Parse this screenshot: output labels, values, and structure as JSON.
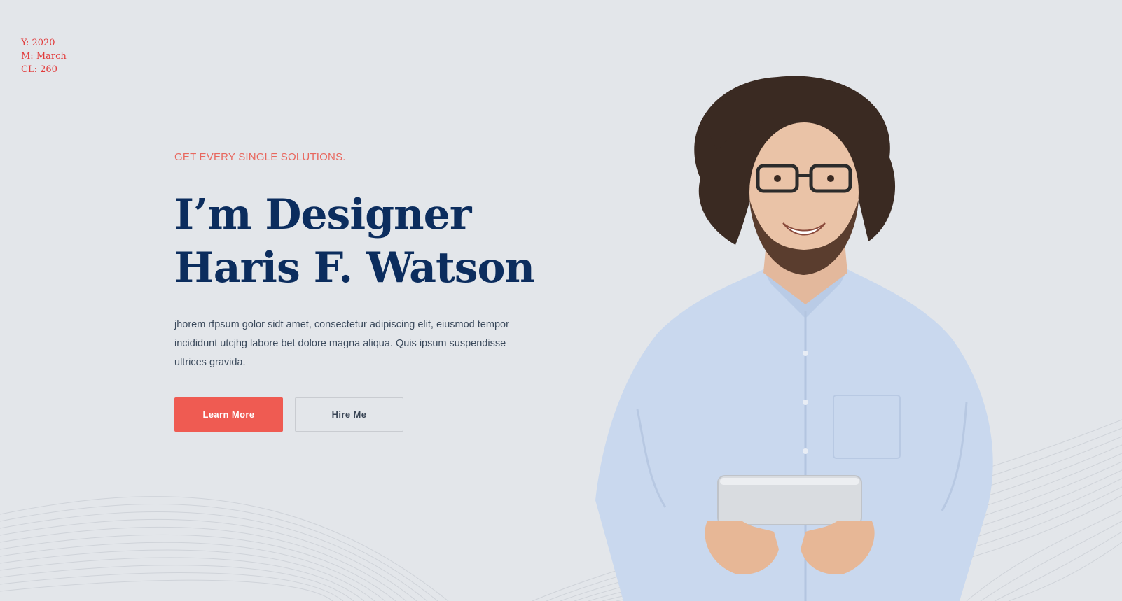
{
  "meta": {
    "year": "Y: 2020",
    "month": "M: March",
    "cl": "CL: 260"
  },
  "hero": {
    "eyebrow": "GET EVERY SINGLE SOLUTIONS.",
    "headline_line1": "I’m Designer",
    "headline_line2": "Haris F. Watson",
    "description": "jhorem rfpsum golor sidt amet, consectetur adipiscing elit, eiusmod tempor incididunt utcjhg labore bet dolore magna aliqua. Quis ipsum suspendisse ultrices gravida.",
    "buttons": {
      "primary_label": "Learn More",
      "secondary_label": "Hire Me"
    }
  },
  "colors": {
    "background": "#e3e6ea",
    "accent": "#ef5b52",
    "heading": "#0c2d5e",
    "body_text": "#3b4a5c",
    "meta_text": "#e23a3a"
  },
  "images": {
    "portrait": "portrait-photo-icon"
  }
}
